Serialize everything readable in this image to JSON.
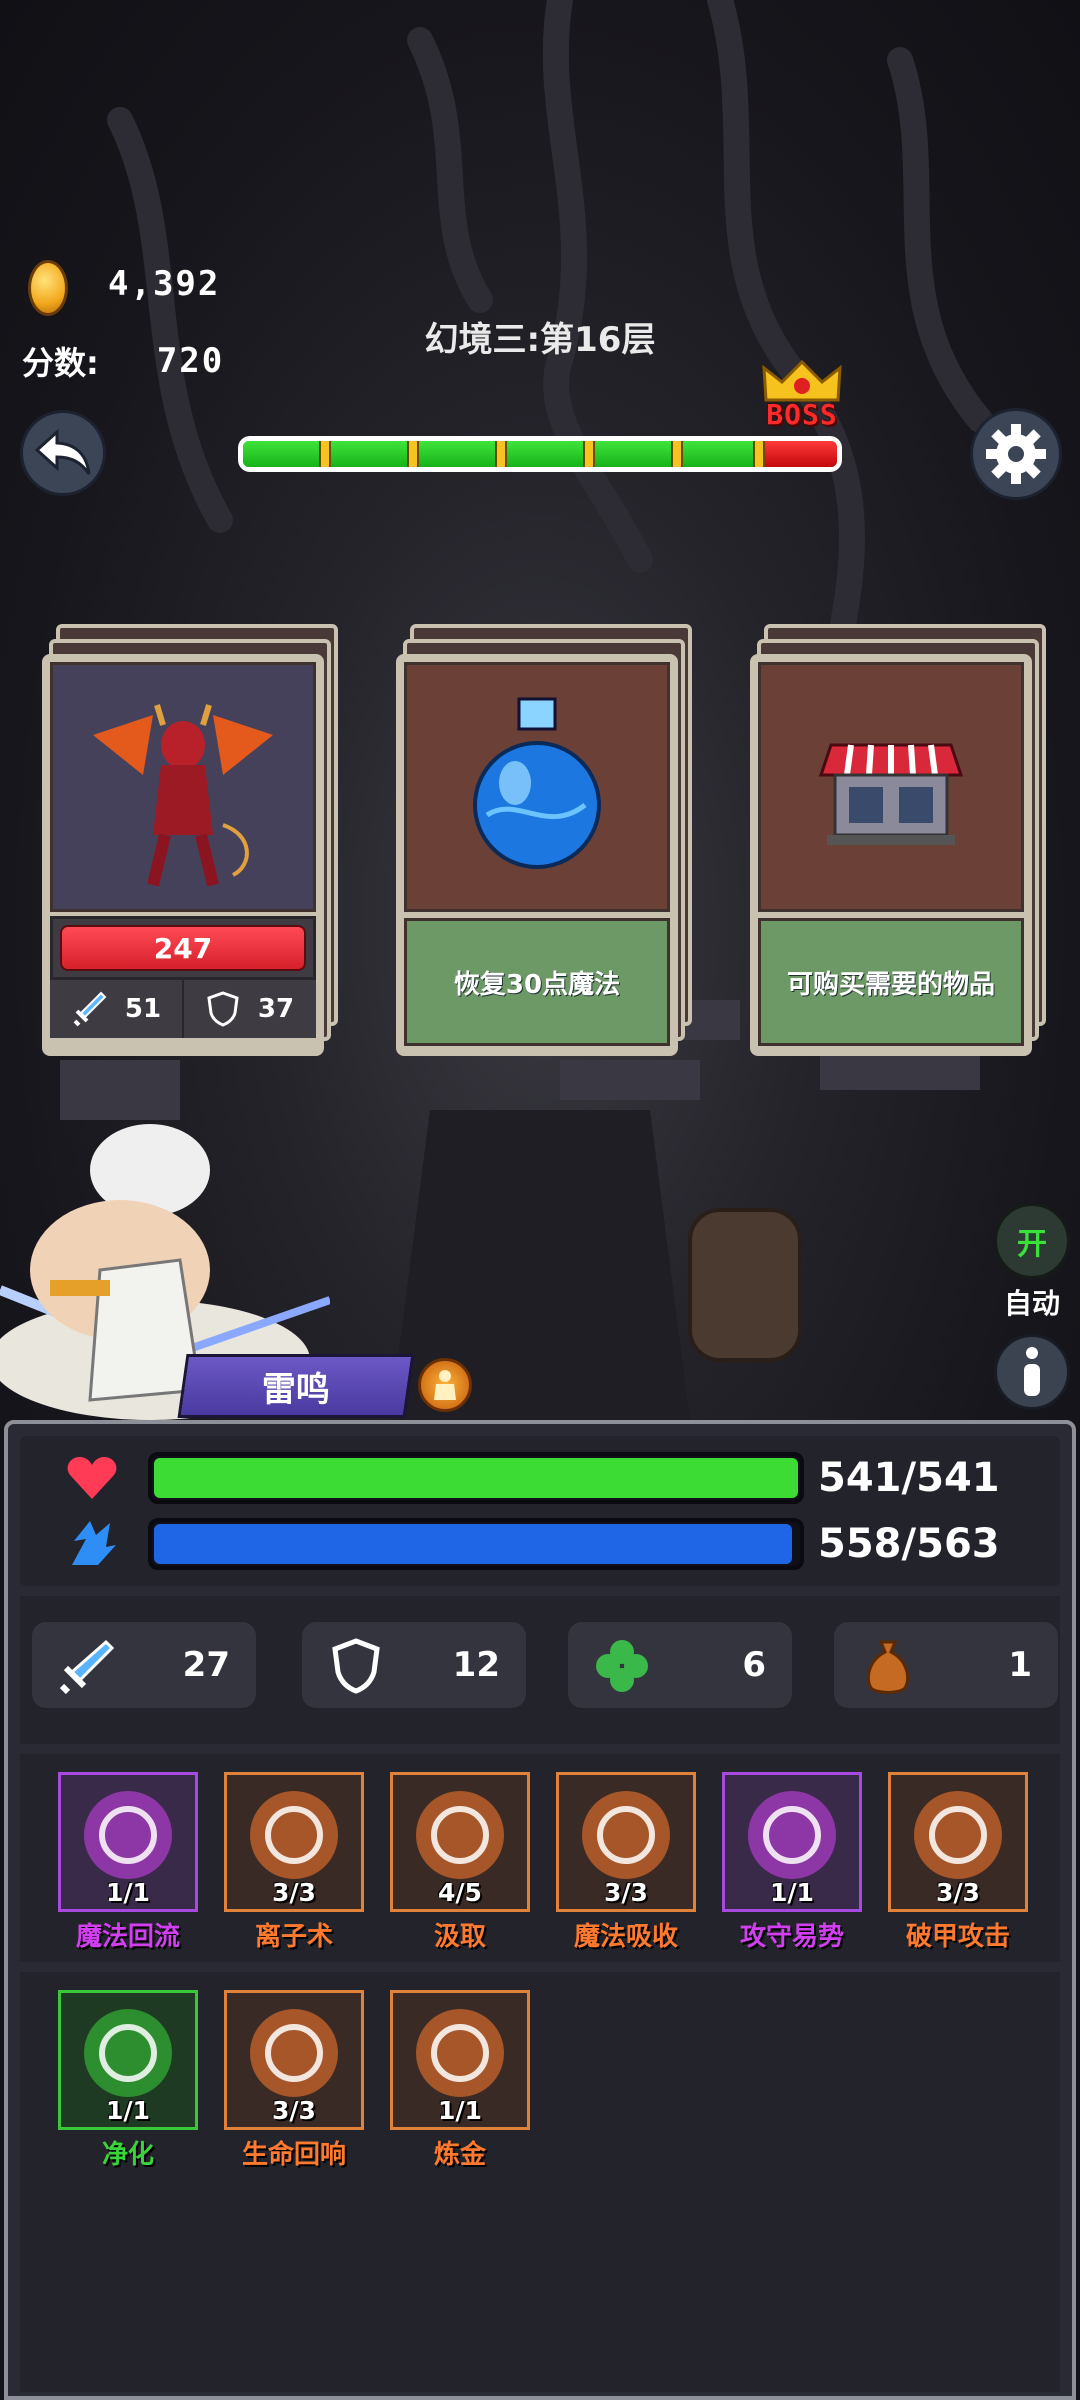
{
  "hud": {
    "coins": "4,392",
    "score_label": "分数:",
    "score": "720",
    "level_title": "幻境三:第16层",
    "boss_label": "BOSS",
    "progress": 0.86
  },
  "cards": [
    {
      "type": "monster",
      "hp": "247",
      "attack": "51",
      "defense": "37"
    },
    {
      "type": "potion",
      "description": "恢复30点魔法"
    },
    {
      "type": "shop",
      "description": "可购买需要的物品"
    }
  ],
  "hero": {
    "name": "雷鸣"
  },
  "side": {
    "auto_toggle": "开",
    "auto_label": "自动"
  },
  "player": {
    "hp_text": "541/541",
    "hp_fraction": 1.0,
    "hp_color": "#3ddc34",
    "mp_text": "558/563",
    "mp_fraction": 0.991,
    "mp_color": "#1f66e6"
  },
  "stats": {
    "attack": "27",
    "defense": "12",
    "luck": "6",
    "bag": "1"
  },
  "skills": [
    {
      "name": "魔法回流",
      "count": "1/1",
      "color": "#d23ff0",
      "frame": "purple",
      "icon": "magic-flow-icon"
    },
    {
      "name": "离子术",
      "count": "3/3",
      "color": "#ff7a2e",
      "frame": "orange",
      "icon": "ion-icon"
    },
    {
      "name": "汲取",
      "count": "4/5",
      "color": "#ff7a2e",
      "frame": "orange",
      "icon": "drain-icon"
    },
    {
      "name": "魔法吸收",
      "count": "3/3",
      "color": "#ff7a2e",
      "frame": "orange",
      "icon": "magic-absorb-icon"
    },
    {
      "name": "攻守易势",
      "count": "1/1",
      "color": "#d23ff0",
      "frame": "purple",
      "icon": "shield-swap-icon"
    },
    {
      "name": "破甲攻击",
      "count": "3/3",
      "color": "#ff7a2e",
      "frame": "orange",
      "icon": "armor-break-icon"
    },
    {
      "name": "净化",
      "count": "1/1",
      "color": "#39d43a",
      "frame": "green",
      "icon": "purify-icon"
    },
    {
      "name": "生命回响",
      "count": "3/3",
      "color": "#ff7a2e",
      "frame": "orange",
      "icon": "life-echo-icon"
    },
    {
      "name": "炼金",
      "count": "1/1",
      "color": "#ff7a2e",
      "frame": "orange",
      "icon": "alchemy-icon"
    }
  ]
}
